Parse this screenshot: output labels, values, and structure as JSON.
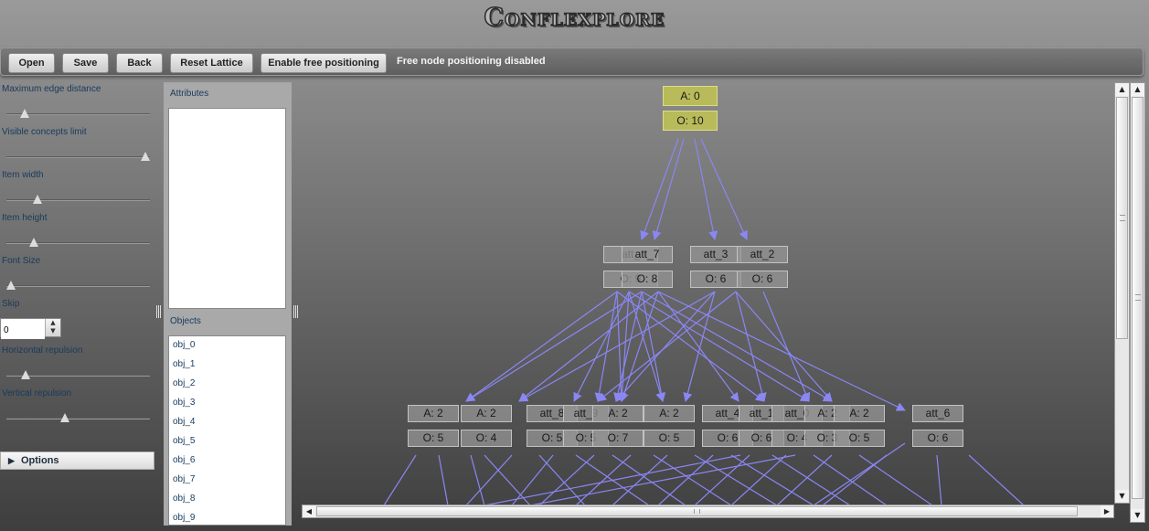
{
  "app": {
    "logo": "Conflexplore"
  },
  "toolbar": {
    "open": "Open",
    "save": "Save",
    "back": "Back",
    "reset": "Reset Lattice",
    "free_pos": "Enable free positioning",
    "status": "Free node positioning disabled"
  },
  "controls": {
    "max_edge": "Maximum edge distance",
    "visible_limit": "Visible concepts limit",
    "item_width": "Item width",
    "item_height": "Item height",
    "font_size": "Font Size",
    "skip": "Skip",
    "skip_value": "0",
    "h_repulsion": "Horizontal repulsion",
    "v_repulsion": "Vertical repulsion",
    "options": "Options",
    "levels": {
      "max_edge": 0.1,
      "visible_limit": 1.0,
      "item_width": 0.2,
      "item_height": 0.17,
      "font_size": 0.0,
      "h_repulsion": 0.11,
      "v_repulsion": 0.4
    }
  },
  "attributes_panel": {
    "title": "Attributes",
    "items": []
  },
  "objects_panel": {
    "title": "Objects",
    "items": [
      "obj_0",
      "obj_1",
      "obj_2",
      "obj_3",
      "obj_4",
      "obj_5",
      "obj_6",
      "obj_7",
      "obj_8",
      "obj_9"
    ]
  },
  "lattice": {
    "top": {
      "a": "A: 0",
      "o": "O: 10"
    },
    "level1": [
      {
        "a": "att_",
        "o": "O: 9"
      },
      {
        "a": "att_7",
        "o": "O: 8"
      },
      {
        "a": "att_3",
        "o": "O: 6"
      },
      {
        "a": "att_2",
        "o": "O: 6"
      }
    ],
    "level2": [
      {
        "a": "A: 2",
        "o": "O: 5"
      },
      {
        "a": "A: 2",
        "o": "O: 4"
      },
      {
        "a": "att_8",
        "o": "O: 5"
      },
      {
        "a": "att_9",
        "o": "O: 5"
      },
      {
        "a": "A: 2",
        "o": "O: 7"
      },
      {
        "a": "A: 2",
        "o": "O: 5"
      },
      {
        "a": "att_4",
        "o": "O: 6"
      },
      {
        "a": "att_1",
        "o": "O: 6"
      },
      {
        "a": "att_0",
        "o": "O: 4"
      },
      {
        "a": "A: 2",
        "o": "O: 3"
      },
      {
        "a": "A: 2",
        "o": "O: 5"
      },
      {
        "a": "att_6",
        "o": "O: 6"
      }
    ]
  },
  "colors": {
    "edge": "#8a87f5",
    "top_node": "#b9bb5a"
  }
}
